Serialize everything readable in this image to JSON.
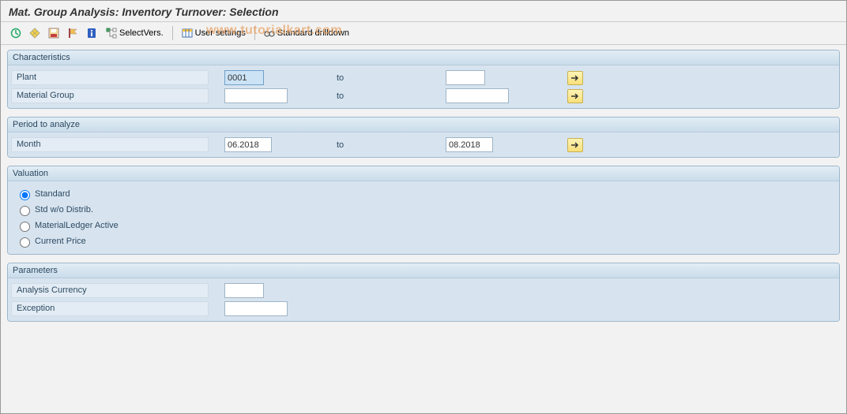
{
  "title": "Mat. Group Analysis: Inventory Turnover: Selection",
  "watermark": "www.tutorialkart.com",
  "toolbar": {
    "select_vers": "SelectVers.",
    "user_settings": "User settings",
    "standard_drilldown": "Standard drilldown"
  },
  "groups": {
    "characteristics": {
      "title": "Characteristics",
      "plant": {
        "label": "Plant",
        "from": "0001",
        "to_label": "to",
        "to": ""
      },
      "material_group": {
        "label": "Material Group",
        "from": "",
        "to_label": "to",
        "to": ""
      }
    },
    "period": {
      "title": "Period to analyze",
      "month": {
        "label": "Month",
        "from": "06.2018",
        "to_label": "to",
        "to": "08.2018"
      }
    },
    "valuation": {
      "title": "Valuation",
      "options": {
        "standard": "Standard",
        "std_wo": "Std w/o Distrib.",
        "ml_active": "MaterialLedger Active",
        "current_price": "Current Price"
      },
      "selected": "standard"
    },
    "parameters": {
      "title": "Parameters",
      "analysis_currency": {
        "label": "Analysis Currency",
        "value": ""
      },
      "exception": {
        "label": "Exception",
        "value": ""
      }
    }
  }
}
